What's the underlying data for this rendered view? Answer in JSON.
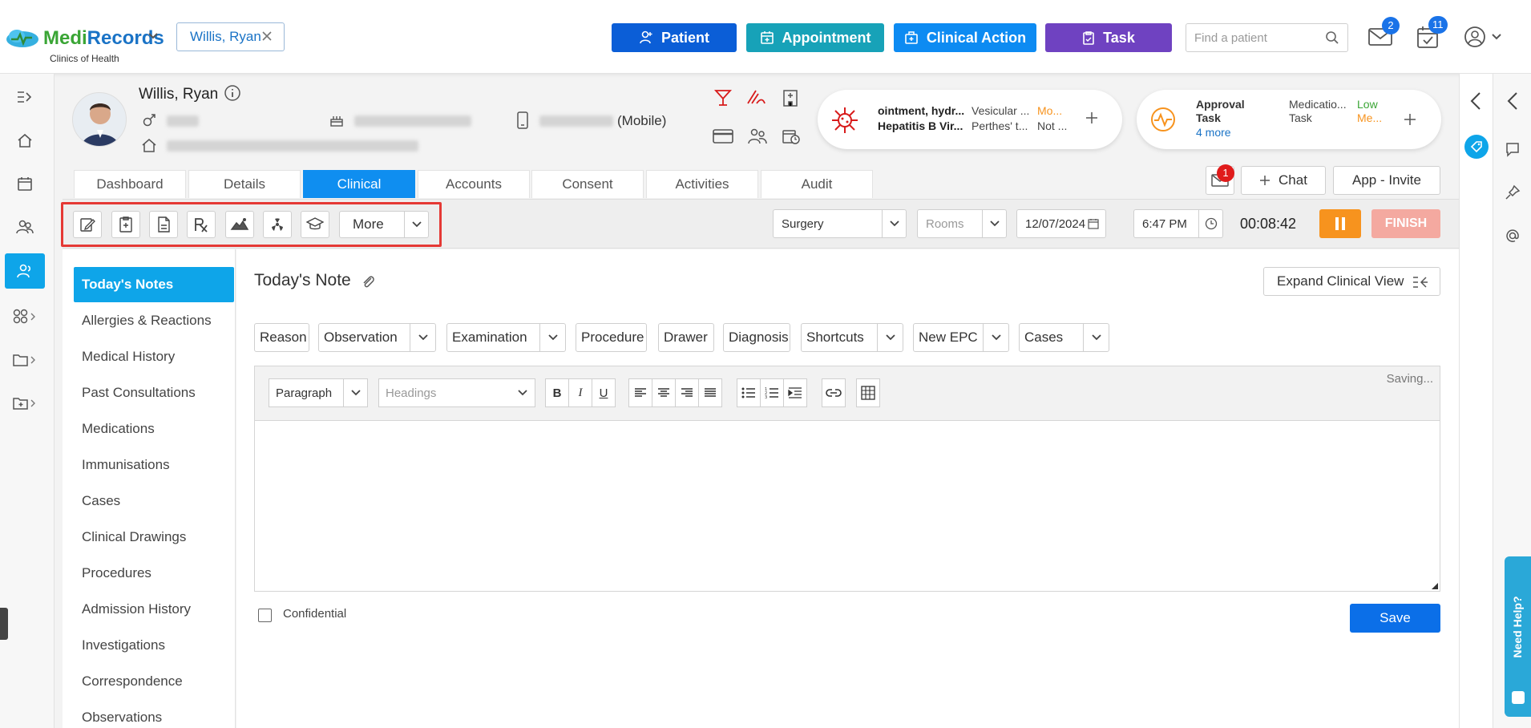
{
  "app": {
    "logo_medi": "Medi",
    "logo_records": "Records",
    "clinic": "Clinics of Health",
    "patient_chip": "Willis, Ryan"
  },
  "topbar": {
    "patient_btn": "Patient",
    "appointment_btn": "Appointment",
    "clinical_action_btn": "Clinical Action",
    "task_btn": "Task",
    "search_placeholder": "Find a patient",
    "mail_badge": "2",
    "calendar_badge": "11"
  },
  "patient": {
    "name": "Willis, Ryan",
    "phone_type": "(Mobile)",
    "alert_line1_a": "ointment, hydr...",
    "alert_line1_b": "Vesicular ...",
    "alert_line1_c": "Mo...",
    "alert_line2_a": "Hepatitis B Vir...",
    "alert_line2_b": "Perthes' t...",
    "alert_line2_c": "Not ...",
    "task_title1": "Approval",
    "task_title2": "Task",
    "task_more": "4 more",
    "task2_title1": "Medicatio...",
    "task2_title2": "Task",
    "task2_p1": "Low",
    "task2_p2": "Me..."
  },
  "tabs": [
    "Dashboard",
    "Details",
    "Clinical",
    "Accounts",
    "Consent",
    "Activities",
    "Audit"
  ],
  "header_right": {
    "msg_badge": "1",
    "chat": "Chat",
    "app_invite": "App - Invite"
  },
  "toolbar": {
    "more": "More",
    "location": "Surgery",
    "rooms": "Rooms",
    "date": "12/07/2024",
    "time": "6:47 PM",
    "timer": "00:08:42",
    "finish": "FINISH"
  },
  "sidenav": [
    "Today's Notes",
    "Allergies & Reactions",
    "Medical History",
    "Past Consultations",
    "Medications",
    "Immunisations",
    "Cases",
    "Clinical Drawings",
    "Procedures",
    "Admission History",
    "Investigations",
    "Correspondence",
    "Observations"
  ],
  "main": {
    "title": "Today's Note",
    "expand": "Expand Clinical View",
    "chips": [
      "Reason",
      "Observation",
      "Examination",
      "Procedure",
      "Drawer",
      "Diagnosis",
      "Shortcuts",
      "New EPC",
      "Cases"
    ],
    "paragraph": "Paragraph",
    "headings": "Headings",
    "saving": "Saving...",
    "confidential": "Confidential",
    "save": "Save"
  },
  "help": "Need Help?",
  "colors": {
    "patient_btn": "#0b5ed7",
    "appointment_btn": "#17a2b8",
    "clinical_btn": "#0d8bf2",
    "task_btn": "#6f42c1",
    "accent": "#0ea5e9",
    "pause": "#f7931e",
    "finish": "#f4a9a0"
  }
}
